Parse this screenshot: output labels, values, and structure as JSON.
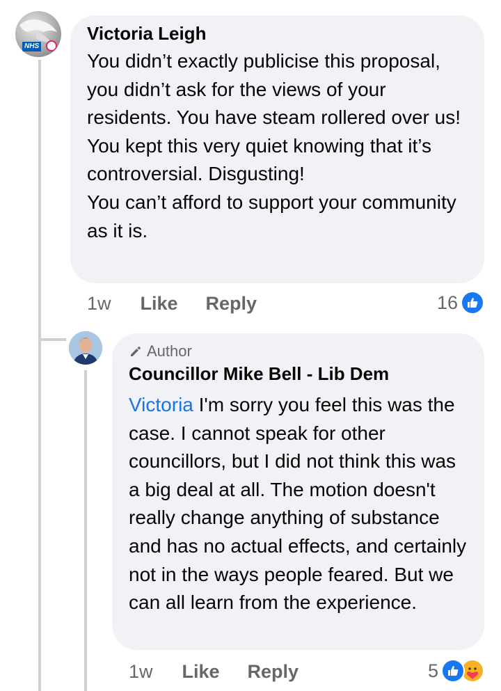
{
  "comment": {
    "author": "Victoria Leigh",
    "avatar_badge": "NHS",
    "text": "You didn’t exactly publicise this proposal, you didn’t ask for the views of your residents. You have steam rollered over us! You kept this very quiet knowing that it’s controversial. Disgusting!\nYou can’t afford to support your community as it is.",
    "time": "1w",
    "like_label": "Like",
    "reply_label": "Reply",
    "reaction_count": "16",
    "reaction_icons": [
      "like-icon"
    ]
  },
  "reply": {
    "badge_label": "Author",
    "badge_icon": "pencil-icon",
    "author": "Councillor Mike Bell - Lib Dem",
    "mention": "Victoria",
    "text": " I'm sorry you feel this was the case. I cannot speak for other councillors, but I did not think this was a big deal at all. The motion doesn't really change anything of substance and has no actual effects, and certainly not in the ways people feared. But we can all learn from the experience.",
    "time": "1w",
    "like_label": "Like",
    "reply_label": "Reply",
    "reaction_count": "5",
    "reaction_icons": [
      "like-icon",
      "care-icon"
    ]
  },
  "colors": {
    "bubble": "#f0f2f5",
    "mention": "#1b74e4",
    "meta_text": "#65676b",
    "like_blue": "#1877f2",
    "care_yellow": "#f7b125"
  }
}
